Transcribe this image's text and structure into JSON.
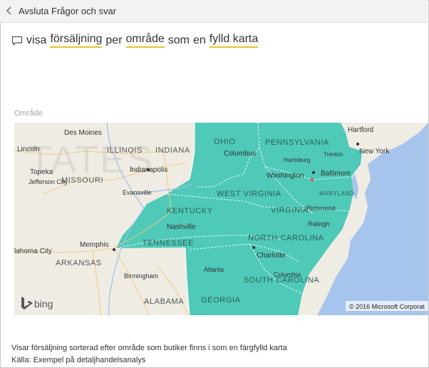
{
  "header": {
    "back_label": "Avsluta Frågor och svar"
  },
  "question": {
    "words": [
      {
        "text": "visa",
        "keyword": false
      },
      {
        "text": "försäljning",
        "keyword": true
      },
      {
        "text": "per",
        "keyword": false
      },
      {
        "text": "område",
        "keyword": true
      },
      {
        "text": "som",
        "keyword": false
      },
      {
        "text": "en",
        "keyword": false
      },
      {
        "text": "fylld karta",
        "keyword": true
      }
    ]
  },
  "visual": {
    "title": "Område",
    "fill_color": "#4fc9b8",
    "water_color": "#a7c5ec",
    "land_color": "#efece4",
    "big_label": "TATES",
    "states_highlighted": [
      "OHIO",
      "PENNSYLVANIA",
      "WEST VIRGINIA",
      "VIRGINIA",
      "KENTUCKY",
      "TENNESSEE",
      "NORTH CAROLINA",
      "SOUTH CAROLINA",
      "GEORGIA",
      "MARYLAND"
    ],
    "state_labels": [
      "ILLINOIS",
      "INDIANA",
      "OHIO",
      "PENNSYLVANIA",
      "MISSOURI",
      "WEST VIRGINIA",
      "KENTUCKY",
      "VIRGINIA",
      "MARYLAND",
      "TENNESSEE",
      "NORTH CAROLINA",
      "ARKANSAS",
      "SOUTH CAROLINA",
      "ALABAMA",
      "GEORGIA"
    ],
    "cities": [
      "Des Moines",
      "Hartford",
      "Lincoln",
      "Trenton",
      "New York",
      "Columbus",
      "Harrisburg",
      "Topeka",
      "Indianapolis",
      "Washington",
      "Baltimore",
      "Jefferson City",
      "Evansville",
      "Richmond",
      "Nashville",
      "Memphis",
      "Raleigh",
      "lahoma City",
      "Charlotte",
      "Atlanta",
      "Birmingham",
      "Columbia"
    ],
    "attribution": "© 2016 Microsoft Corporat",
    "logo_text": "bing"
  },
  "footer": {
    "description": "Visar försäljning sorterad efter område som butiker finns i som en färgfylld karta",
    "source": "Källa: Exempel på detaljhandelsanalys"
  }
}
